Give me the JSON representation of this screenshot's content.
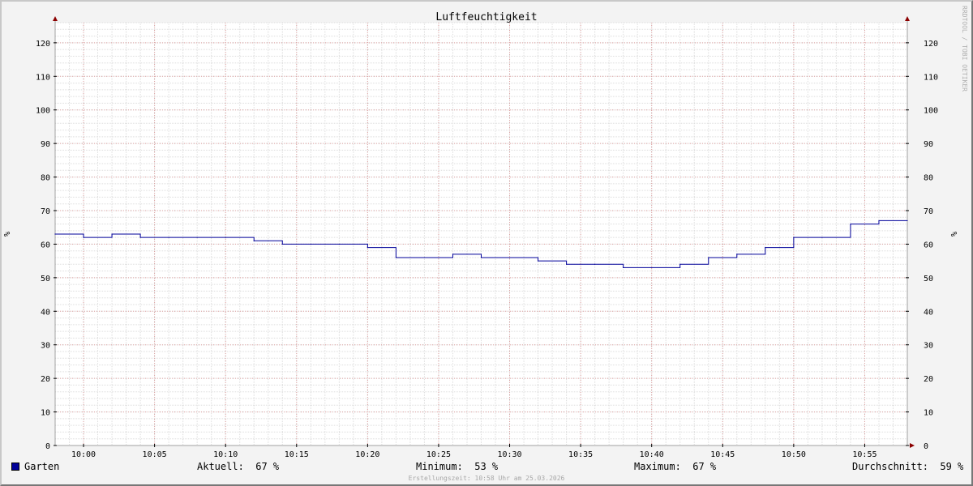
{
  "watermark": "RRDTOOL / TOBI OETIKER",
  "colors": {
    "background": "#f3f3f3",
    "plot_background": "#ffffff",
    "major_grid": "#e0a0a0",
    "minor_grid": "#dddddd",
    "axis": "#a0a0a0",
    "arrow": "#8b0000",
    "series": "#000099"
  },
  "chart_data": {
    "type": "line",
    "step": true,
    "title": "Luftfeuchtigkeit",
    "xlabel": "",
    "ylabel": "%",
    "y2label": "%",
    "ylim": [
      0,
      126
    ],
    "yticks": [
      0,
      10,
      20,
      30,
      40,
      50,
      60,
      70,
      80,
      90,
      100,
      110,
      120
    ],
    "x_range_minutes": [
      "09:58",
      "10:58"
    ],
    "xticks": [
      "10:00",
      "10:05",
      "10:10",
      "10:15",
      "10:20",
      "10:25",
      "10:30",
      "10:35",
      "10:40",
      "10:45",
      "10:50",
      "10:55"
    ],
    "grid": true,
    "legend_position": "bottom",
    "series": [
      {
        "name": "Garten",
        "color": "#000099",
        "x": [
          "09:58",
          "10:00",
          "10:02",
          "10:04",
          "10:06",
          "10:08",
          "10:10",
          "10:12",
          "10:14",
          "10:16",
          "10:18",
          "10:20",
          "10:22",
          "10:24",
          "10:26",
          "10:28",
          "10:30",
          "10:32",
          "10:34",
          "10:36",
          "10:38",
          "10:40",
          "10:42",
          "10:44",
          "10:46",
          "10:48",
          "10:50",
          "10:52",
          "10:54",
          "10:56",
          "10:58"
        ],
        "values": [
          63,
          62,
          63,
          62,
          62,
          62,
          62,
          61,
          60,
          60,
          60,
          59,
          56,
          56,
          57,
          56,
          56,
          55,
          54,
          54,
          53,
          53,
          54,
          56,
          57,
          59,
          62,
          62,
          66,
          67,
          67
        ]
      }
    ]
  },
  "legend": {
    "series_name": "Garten",
    "series_color": "#000099",
    "aktuell": "Aktuell:  67 %",
    "minimum": "Minimum:  53 %",
    "maximum": "Maximum:  67 %",
    "durchschnitt": "Durchschnitt:  59 %"
  },
  "footer": "Erstellungszeit: 10:58 Uhr am 25.03.2026"
}
